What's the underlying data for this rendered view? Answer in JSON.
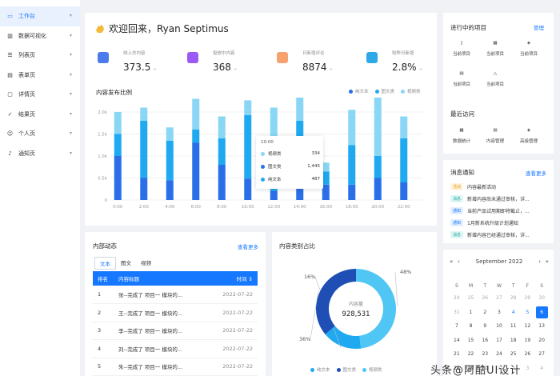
{
  "sidebar": {
    "items": [
      {
        "label": "工作台",
        "active": true,
        "icon": "desktop-icon"
      },
      {
        "label": "数据可视化",
        "icon": "chart-icon"
      },
      {
        "label": "列表页",
        "icon": "list-icon"
      },
      {
        "label": "表单页",
        "icon": "form-icon"
      },
      {
        "label": "详情页",
        "icon": "detail-icon"
      },
      {
        "label": "结果页",
        "icon": "check-circle-icon"
      },
      {
        "label": "个人页",
        "icon": "user-icon"
      },
      {
        "label": "通知页",
        "icon": "bell-icon"
      }
    ]
  },
  "welcome": {
    "text": "欢迎回来，Ryan Septimus"
  },
  "stats": [
    {
      "label": "线上总内容",
      "value": "373.5",
      "color": "#4b7bec"
    },
    {
      "label": "投放中内容",
      "value": "368",
      "color": "#9b59f5"
    },
    {
      "label": "日新增评论",
      "value": "8874",
      "color": "#f6a26e"
    },
    {
      "label": "较昨日新增",
      "value": "2.8%",
      "color": "#2fa8e8"
    }
  ],
  "arrow": "→",
  "chart_main": {
    "title": "内容发布比例"
  },
  "chart_data": {
    "type": "bar",
    "stacked": true,
    "categories": [
      "0:00",
      "2:00",
      "4:00",
      "6:00",
      "8:00",
      "10:00",
      "12:00",
      "14:00",
      "16:00",
      "18:00",
      "20:00",
      "22:00"
    ],
    "series": [
      {
        "name": "纯文本",
        "values": [
          1000,
          500,
          450,
          1300,
          800,
          487,
          200,
          1400,
          350,
          350,
          500,
          400
        ],
        "color": "#2a6ee8"
      },
      {
        "name": "图文类",
        "values": [
          500,
          1300,
          900,
          300,
          600,
          1445,
          900,
          400,
          300,
          900,
          500,
          1000
        ],
        "color": "#1fa9f0"
      },
      {
        "name": "视频类",
        "values": [
          500,
          300,
          300,
          700,
          500,
          334,
          1000,
          900,
          200,
          800,
          1400,
          500
        ],
        "color": "#8ad7f5"
      }
    ],
    "ylim": [
      0,
      2000
    ],
    "yticks": [
      "0",
      "0.5k",
      "1.0k",
      "1.5k",
      "2.0k"
    ],
    "tooltip": {
      "title": "10:00",
      "items": [
        {
          "name": "视频类",
          "value": "334",
          "color": "#8ad7f5"
        },
        {
          "name": "图文类",
          "value": "1,445",
          "color": "#2a6ee8"
        },
        {
          "name": "纯文本",
          "value": "487",
          "color": "#1fa9f0"
        }
      ]
    },
    "pie": {
      "title": "内容类别占比",
      "center_label": "内容量",
      "center_value": "928,531",
      "slices": [
        {
          "name": "纯文本",
          "value": 16,
          "label": "16%",
          "color": "#1fa9f0"
        },
        {
          "name": "图文类",
          "value": 36,
          "label": "36%",
          "color": "#1f4fb5"
        },
        {
          "name": "视频类",
          "value": 48,
          "label": "48%",
          "color": "#4fc6f3"
        }
      ]
    }
  },
  "news": {
    "title": "内部动态",
    "more": "查看更多",
    "tabs": [
      "文本",
      "图文",
      "视频"
    ],
    "headers": {
      "no": "排名",
      "title": "内容标题",
      "time": "时间 ↕"
    },
    "rows": [
      {
        "no": "1",
        "title": "张--完成了 项目一 模块的...",
        "time": "2022-07-22"
      },
      {
        "no": "2",
        "title": "王--完成了 项目一 模块的...",
        "time": "2022-07-22"
      },
      {
        "no": "3",
        "title": "李--完成了 项目一 模块的...",
        "time": "2022-07-22"
      },
      {
        "no": "4",
        "title": "刘--完成了 项目一 模块的...",
        "time": "2022-07-22"
      },
      {
        "no": "5",
        "title": "朱--完成了 项目一 模块的...",
        "time": "2022-07-22"
      }
    ]
  },
  "projects": {
    "title": "进行中的项目",
    "manage": "管理",
    "items": [
      "当前项目",
      "当前项目",
      "当前项目",
      "当前项目",
      "当前项目"
    ]
  },
  "recent": {
    "title": "最近访问",
    "items": [
      "数据统计",
      "内容管理",
      "高级管理"
    ]
  },
  "messages": {
    "title": "消息通知",
    "more": "查看更多",
    "items": [
      {
        "tag": "活动",
        "kind": "a",
        "text": "内容最新活动"
      },
      {
        "tag": "消息",
        "kind": "t",
        "text": "新增内容尚未通过审核，详..."
      },
      {
        "tag": "通知",
        "kind": "n",
        "text": "当前产品试用期即将截止，..."
      },
      {
        "tag": "通知",
        "kind": "n",
        "text": "1月新系统升级计划通知"
      },
      {
        "tag": "消息",
        "kind": "t",
        "text": "新增内容已经通过审核，详..."
      }
    ]
  },
  "calendar": {
    "nav": {
      "prev2": "«",
      "prev": "‹",
      "next": "›",
      "next2": "»"
    },
    "month": "September 2022",
    "weekdays": [
      "S",
      "M",
      "T",
      "W",
      "T",
      "F",
      "S"
    ],
    "days": [
      [
        "24",
        "25",
        "26",
        "27",
        "28",
        "29",
        "30"
      ],
      [
        "31",
        "1",
        "2",
        "3",
        "4",
        "5",
        "6"
      ],
      [
        "7",
        "8",
        "9",
        "10",
        "11",
        "12",
        "13"
      ],
      [
        "14",
        "15",
        "16",
        "17",
        "18",
        "19",
        "20"
      ],
      [
        "21",
        "22",
        "23",
        "24",
        "25",
        "26",
        "27"
      ],
      [
        "28",
        "29",
        "30",
        "1",
        "2",
        "3",
        "4"
      ]
    ],
    "today": "6"
  },
  "watermark": "头条@阿酷UI设计"
}
